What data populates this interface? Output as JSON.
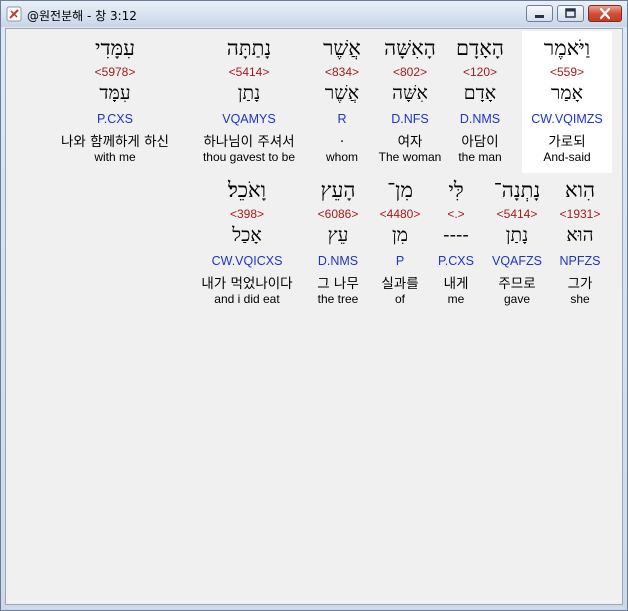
{
  "window": {
    "title": "@원전분해 - 창 3:12",
    "buttons": {
      "minimize": "minimize",
      "maximize": "maximize",
      "close": "close"
    }
  },
  "rows": [
    {
      "words": [
        {
          "hebrew": "וַיֹּאמֶר",
          "strong": "<559>",
          "root": "אָמַר",
          "code": "CW.VQIMZS",
          "korean": "가로되",
          "english": "And-said",
          "highlighted": true
        },
        {
          "hebrew": "הָאָדָם",
          "strong": "<120>",
          "root": "אָדָם",
          "code": "D.NMS",
          "korean": "아담이",
          "english": "the man"
        },
        {
          "hebrew": "הָאִשָּׁה",
          "strong": "<802>",
          "root": "אִשָּׁה",
          "code": "D.NFS",
          "korean": "여자",
          "english": "The woman"
        },
        {
          "hebrew": "אֲשֶׁר",
          "strong": "<834>",
          "root": "אֲשֶׁר",
          "code": "R",
          "korean": ".",
          "english": "whom"
        },
        {
          "hebrew": "נָתַתָּה",
          "strong": "<5414>",
          "root": "נָתַן",
          "code": "VQAMYS",
          "korean": "하나님이 주셔서",
          "english": "thou gavest to be"
        },
        {
          "hebrew": "עִמָּדִי",
          "strong": "<5978>",
          "root": "עִמָּד",
          "code": "P.CXS",
          "korean": "나와 함께하게 하신",
          "english": "with me"
        }
      ]
    },
    {
      "words": [
        {
          "hebrew": "הִוא",
          "strong": "<1931>",
          "root": "הוּא",
          "code": "NPFZS",
          "korean": "그가",
          "english": "she"
        },
        {
          "hebrew": "נָתְנָה־",
          "strong": "<5414>",
          "root": "נָתַן",
          "code": "VQAFZS",
          "korean": "주므로",
          "english": "gave"
        },
        {
          "hebrew": "לִּי",
          "strong": "<.>",
          "root": "----",
          "code": "P.CXS",
          "korean": "내게",
          "english": "me"
        },
        {
          "hebrew": "מִן־",
          "strong": "<4480>",
          "root": "מִן",
          "code": "P",
          "korean": "실과를",
          "english": "of"
        },
        {
          "hebrew": "הָעֵץ",
          "strong": "<6086>",
          "root": "עֵץ",
          "code": "D.NMS",
          "korean": "그 나무",
          "english": "the tree"
        },
        {
          "hebrew": "וָאֹכֵל׃",
          "strong": "<398>",
          "root": "אָכַל",
          "code": "CW.VQICXS",
          "korean": "내가 먹었나이다",
          "english": "and i did eat"
        }
      ]
    }
  ]
}
